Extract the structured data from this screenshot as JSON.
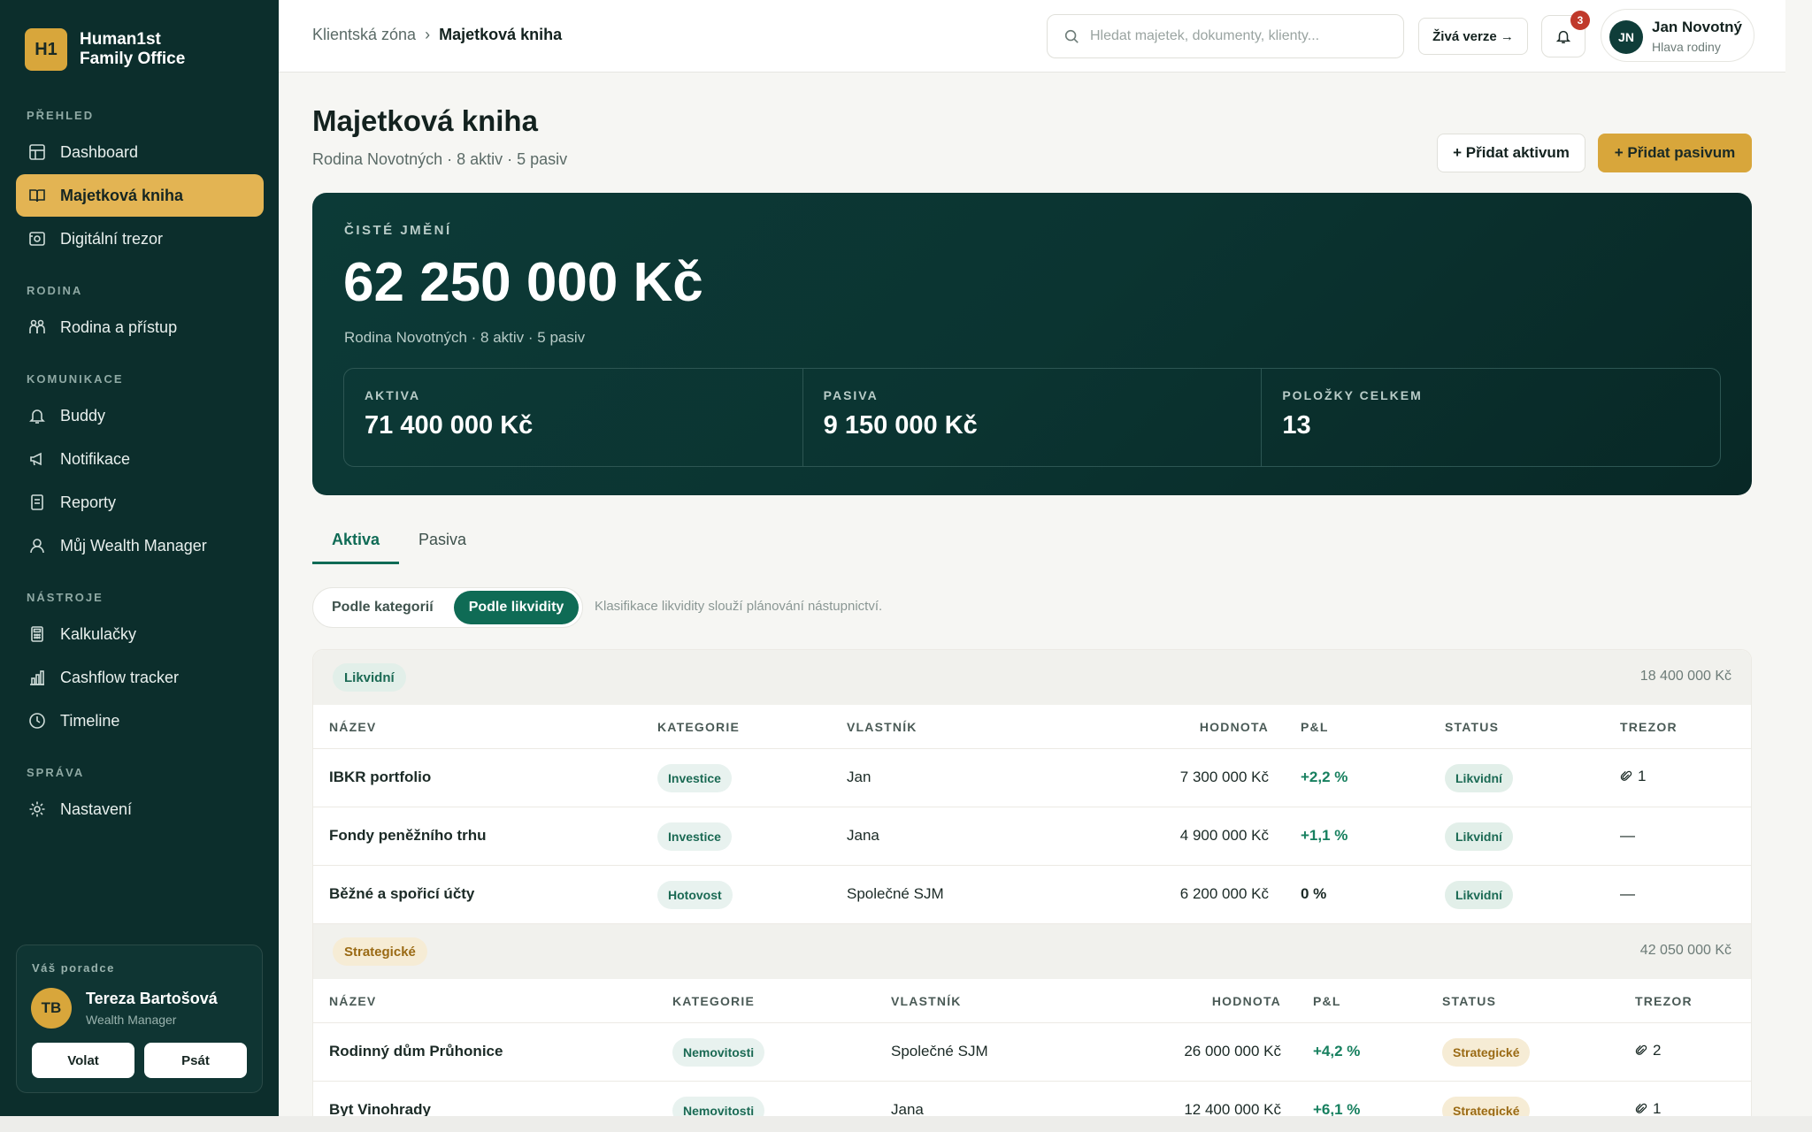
{
  "brand": {
    "logo": "H1",
    "name_line1": "Human1st",
    "name_line2": "Family Office"
  },
  "nav": {
    "sections": [
      {
        "title": "PŘEHLED",
        "items": [
          {
            "label": "Dashboard",
            "icon": "grid-icon"
          },
          {
            "label": "Majetková kniha",
            "icon": "book-icon",
            "active": true
          },
          {
            "label": "Digitální trezor",
            "icon": "safe-icon"
          }
        ]
      },
      {
        "title": "RODINA",
        "items": [
          {
            "label": "Rodina a přístup",
            "icon": "family-icon"
          }
        ]
      },
      {
        "title": "KOMUNIKACE",
        "items": [
          {
            "label": "Buddy",
            "icon": "bell-icon"
          },
          {
            "label": "Notifikace",
            "icon": "megaphone-icon"
          },
          {
            "label": "Reporty",
            "icon": "report-icon"
          },
          {
            "label": "Můj Wealth Manager",
            "icon": "user-icon"
          }
        ]
      },
      {
        "title": "NÁSTROJE",
        "items": [
          {
            "label": "Kalkulačky",
            "icon": "calculator-icon"
          },
          {
            "label": "Cashflow tracker",
            "icon": "chart-icon"
          },
          {
            "label": "Timeline",
            "icon": "clock-icon"
          }
        ]
      },
      {
        "title": "SPRÁVA",
        "items": [
          {
            "label": "Nastavení",
            "icon": "gear-icon"
          }
        ]
      }
    ]
  },
  "advisor": {
    "label": "Váš poradce",
    "initials": "TB",
    "name": "Tereza Bartošová",
    "role": "Wealth Manager",
    "call": "Volat",
    "write": "Psát"
  },
  "header": {
    "crumb_root": "Klientská zóna",
    "crumb_sep": "›",
    "crumb_current": "Majetková kniha",
    "search_placeholder": "Hledat majetek, dokumenty, klienty...",
    "live": "Živá verze →",
    "notif_count": "3",
    "user_initials": "JN",
    "user_name": "Jan Novotný",
    "user_role": "Hlava rodiny"
  },
  "page": {
    "title": "Majetková kniha",
    "subtitle": "Rodina Novotných · 8 aktiv · 5 pasiv",
    "add_asset": "+ Přidat aktivum",
    "add_liability": "+ Přidat pasivum"
  },
  "hero": {
    "label": "ČISTÉ JMĚNÍ",
    "value": "62 250 000 Kč",
    "sub": "Rodina Novotných · 8 aktiv · 5 pasiv",
    "stats": [
      {
        "label": "AKTIVA",
        "value": "71 400 000 Kč"
      },
      {
        "label": "PASIVA",
        "value": "9 150 000 Kč"
      },
      {
        "label": "POLOŽKY CELKEM",
        "value": "13"
      }
    ]
  },
  "tabs": {
    "assets": "Aktiva",
    "liabilities": "Pasiva"
  },
  "segment": {
    "by_category": "Podle kategorií",
    "by_liquidity": "Podle likvidity",
    "note": "Klasifikace likvidity slouží plánování nástupnictví."
  },
  "columns": {
    "name": "NÁZEV",
    "category": "KATEGORIE",
    "owner": "VLASTNÍK",
    "value": "HODNOTA",
    "pl": "P&L",
    "status": "STATUS",
    "vault": "TREZOR"
  },
  "groups": [
    {
      "label": "Likvidní",
      "total": "18 400 000 Kč",
      "tone": "green",
      "rows": [
        {
          "name": "IBKR portfolio",
          "category": "Investice",
          "owner": "Jan",
          "value": "7 300 000 Kč",
          "pl": "+2,2 %",
          "status": "Likvidní",
          "vault": "1"
        },
        {
          "name": "Fondy peněžního trhu",
          "category": "Investice",
          "owner": "Jana",
          "value": "4 900 000 Kč",
          "pl": "+1,1 %",
          "status": "Likvidní",
          "vault": "—"
        },
        {
          "name": "Běžné a spořicí účty",
          "category": "Hotovost",
          "owner": "Společné SJM",
          "value": "6 200 000 Kč",
          "pl": "0 %",
          "status": "Likvidní",
          "vault": "—"
        }
      ]
    },
    {
      "label": "Strategické",
      "total": "42 050 000 Kč",
      "tone": "gold",
      "rows": [
        {
          "name": "Rodinný dům Průhonice",
          "category": "Nemovitosti",
          "owner": "Společné SJM",
          "value": "26 000 000 Kč",
          "pl": "+4,2 %",
          "status": "Strategické",
          "vault": "2"
        },
        {
          "name": "Byt Vinohrady",
          "category": "Nemovitosti",
          "owner": "Jana",
          "value": "12 400 000 Kč",
          "pl": "+6,1 %",
          "status": "Strategické",
          "vault": "1"
        }
      ]
    }
  ]
}
